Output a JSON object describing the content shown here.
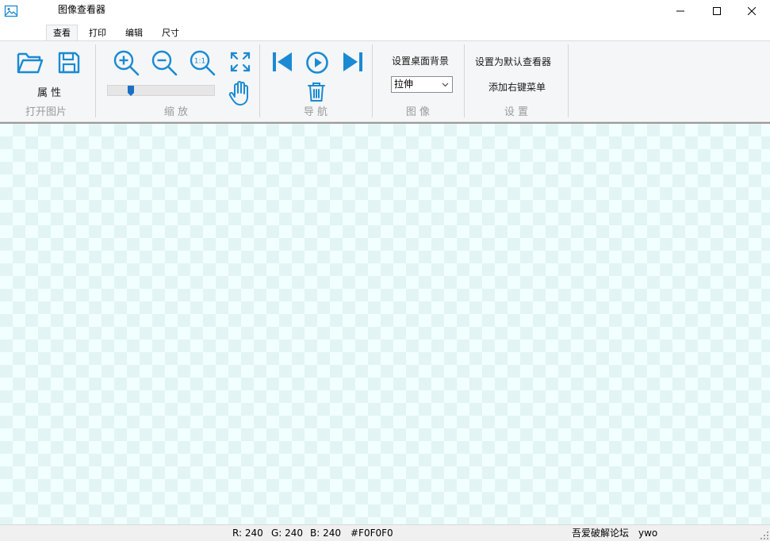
{
  "window": {
    "title": "图像查看器"
  },
  "tabs": [
    {
      "label": "查看",
      "active": true
    },
    {
      "label": "打印",
      "active": false
    },
    {
      "label": "编辑",
      "active": false
    },
    {
      "label": "尺寸",
      "active": false
    }
  ],
  "ribbon": {
    "open_group": {
      "properties_label": "属 性",
      "group_label": "打开图片"
    },
    "zoom_group": {
      "group_label": "缩 放",
      "zoom_level": 0.2
    },
    "nav_group": {
      "group_label": "导 航"
    },
    "image_group": {
      "set_wallpaper_label": "设置桌面背景",
      "fit_value": "拉伸",
      "group_label": "图 像"
    },
    "settings_group": {
      "default_viewer_label": "设置为默认查看器",
      "context_menu_label": "添加右键菜单",
      "group_label": "设 置"
    }
  },
  "status": {
    "r": "R: 240",
    "g": "G: 240",
    "b": "B: 240",
    "hex": "#F0F0F0",
    "forum": "吾爱破解论坛",
    "author": "ywo"
  },
  "colors": {
    "accent": "#1a8ad4",
    "canvas_light": "#f1ffff",
    "canvas_dark": "#e3f4f4"
  }
}
